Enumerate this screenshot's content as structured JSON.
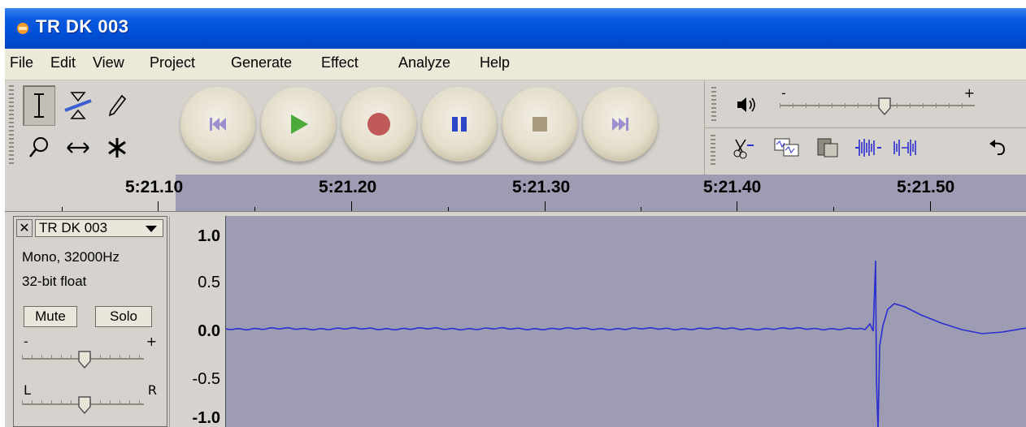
{
  "window": {
    "title": "TR DK 003",
    "icon": "audacity-app-icon"
  },
  "menu": {
    "items": [
      "File",
      "Edit",
      "View",
      "Project",
      "Generate",
      "Effect",
      "Analyze",
      "Help"
    ]
  },
  "toolbar": {
    "tools": [
      "selection-tool",
      "envelope-tool",
      "draw-tool",
      "zoom-tool",
      "time-shift-tool",
      "multi-tool"
    ],
    "active_tool": "selection-tool",
    "transport": [
      "skip-to-start",
      "play",
      "record",
      "pause",
      "stop",
      "skip-to-end"
    ],
    "colors": {
      "play": "#4caa3a",
      "record": "#c05a5a",
      "pause": "#2d46c8",
      "stop": "#a99a7f",
      "skip": "#9b8fcf"
    },
    "volume": {
      "minus": "-",
      "plus": "+",
      "level": 0.55
    },
    "edit_tools": [
      "trim-outside-icon",
      "silence-icon",
      "paste-icon",
      "fit-selection-icon",
      "fit-project-icon",
      "undo-icon"
    ]
  },
  "ruler": {
    "labels": [
      "5:21.10",
      "5:21.20",
      "5:21.30",
      "5:21.40",
      "5:21.50"
    ]
  },
  "track": {
    "name": "TR DK 003",
    "format": "Mono, 32000Hz",
    "sample": "32-bit float",
    "mute": "Mute",
    "solo": "Solo",
    "gain": {
      "minus": "-",
      "plus": "+",
      "level": 0.5
    },
    "pan": {
      "left": "L",
      "right": "R",
      "level": 0.5
    },
    "scale": [
      "1.0",
      "0.5",
      "0.0",
      "-0.5",
      "-1.0"
    ],
    "waveform_color": "#2b2ed0",
    "background_color": "#9d9cb3"
  }
}
